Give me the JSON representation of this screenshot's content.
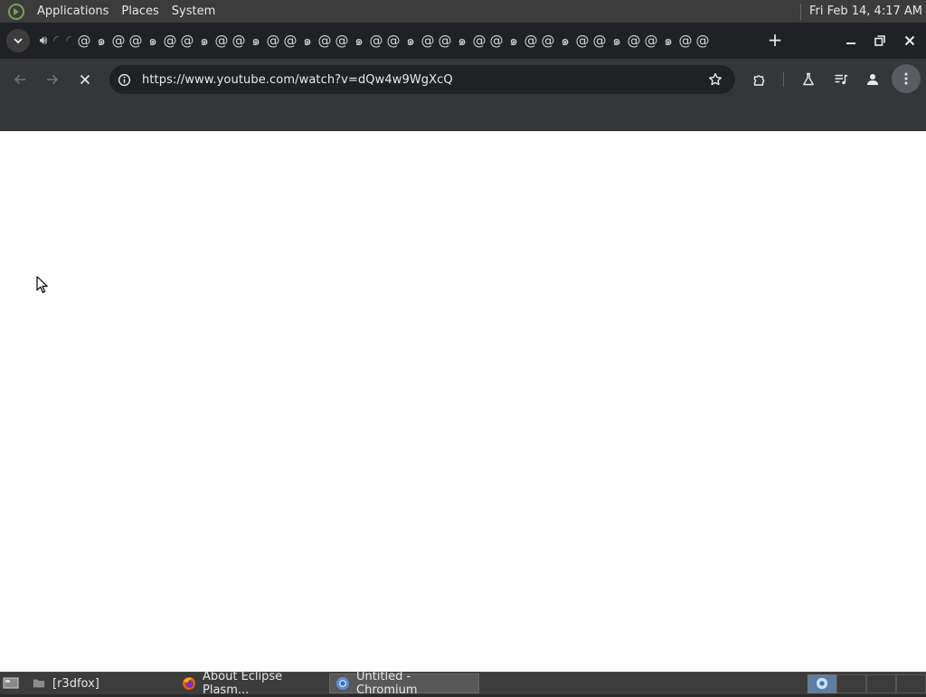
{
  "top_panel": {
    "menu": [
      "Applications",
      "Places",
      "System"
    ],
    "clock": "Fri Feb 14,  4:17 AM"
  },
  "tabstrip": {
    "tab_count_glyphs": 37,
    "new_tab_label": "+"
  },
  "toolbar": {
    "url": "https://www.youtube.com/watch?v=dQw4w9WgXcQ"
  },
  "taskbar": {
    "tasks": [
      {
        "label": "[r3dfox]",
        "icon": "folder-icon",
        "active": false
      },
      {
        "label": "About Eclipse Plasm...",
        "icon": "firefox-icon",
        "active": false
      },
      {
        "label": "Untitled - Chromium",
        "icon": "chromium-icon",
        "active": true
      }
    ]
  },
  "colors": {
    "panel": "#3c3c3c",
    "tabstrip": "#202124",
    "toolbar": "#35363a",
    "omnibox": "#202124",
    "page": "#ffffff"
  }
}
